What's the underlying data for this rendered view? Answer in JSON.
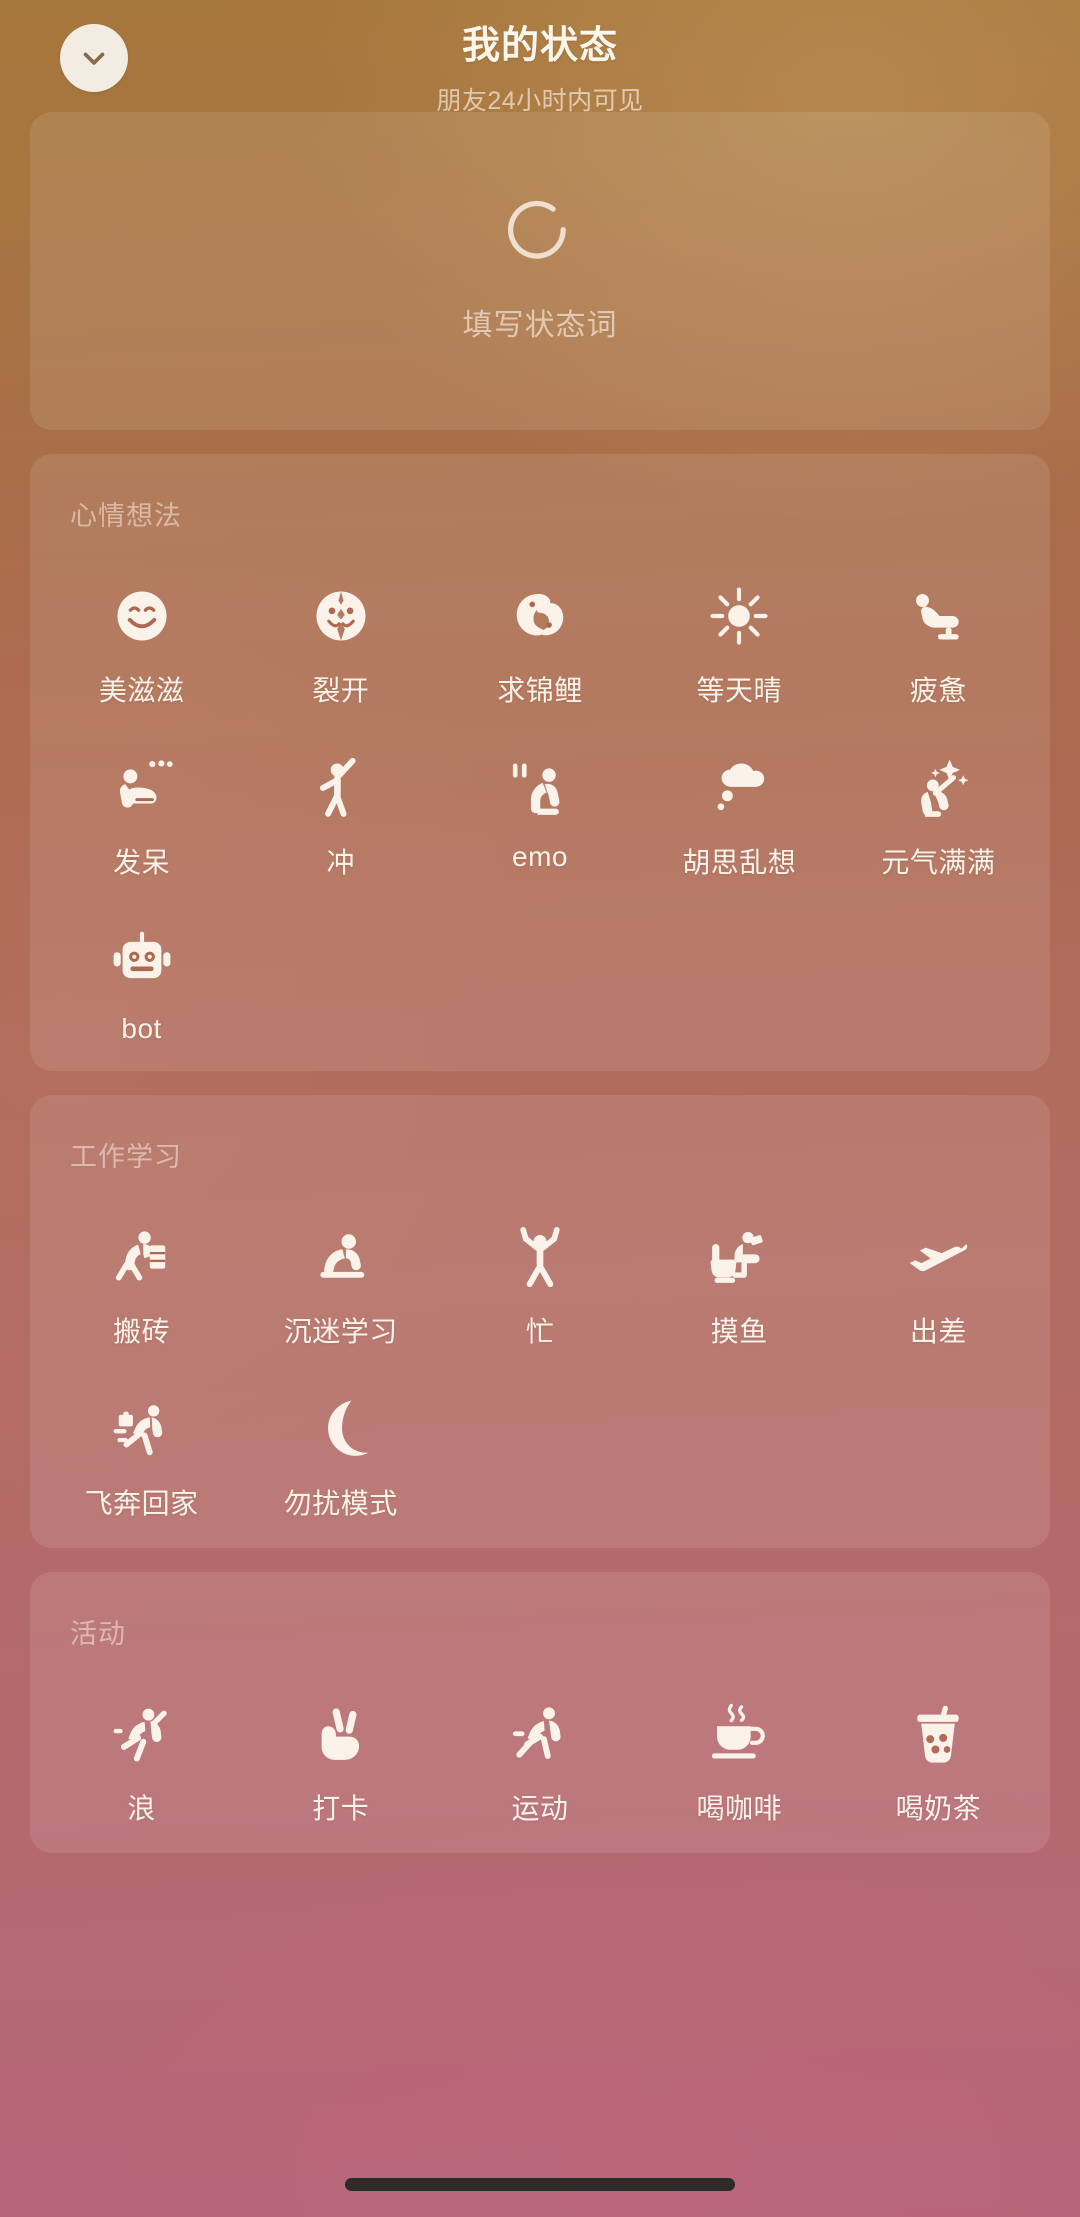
{
  "header": {
    "title": "我的状态",
    "subtitle": "朋友24小时内可见",
    "close_icon": "chevron-down-icon"
  },
  "composer": {
    "icon": "circle-ring-icon",
    "placeholder": "填写状态词"
  },
  "colors": {
    "gradient_top": "#a6773c",
    "gradient_mid": "#b06b5b",
    "gradient_bottom": "#b6657a",
    "card_fill": "rgba(255,255,255,0.10)",
    "icon_fill": "#fbf2ea",
    "label_color": "#fbf2ea",
    "section_title_color": "rgba(255,246,238,0.50)"
  },
  "sections": [
    {
      "title": "心情想法",
      "items": [
        {
          "label": "美滋滋",
          "icon": "smiling-face-icon"
        },
        {
          "label": "裂开",
          "icon": "cracked-face-icon"
        },
        {
          "label": "求锦鲤",
          "icon": "koi-fish-icon"
        },
        {
          "label": "等天晴",
          "icon": "sun-icon"
        },
        {
          "label": "疲惫",
          "icon": "exhausted-person-icon"
        },
        {
          "label": "发呆",
          "icon": "daydreaming-person-icon"
        },
        {
          "label": "冲",
          "icon": "cheering-person-icon"
        },
        {
          "label": "emo",
          "icon": "crouching-person-icon"
        },
        {
          "label": "胡思乱想",
          "icon": "thought-cloud-icon"
        },
        {
          "label": "元气满满",
          "icon": "sparkle-person-icon"
        },
        {
          "label": "bot",
          "icon": "robot-head-icon"
        }
      ]
    },
    {
      "title": "工作学习",
      "items": [
        {
          "label": "搬砖",
          "icon": "carrying-bricks-icon"
        },
        {
          "label": "沉迷学习",
          "icon": "studying-person-icon"
        },
        {
          "label": "忙",
          "icon": "busy-person-icon"
        },
        {
          "label": "摸鱼",
          "icon": "toilet-phone-icon"
        },
        {
          "label": "出差",
          "icon": "airplane-icon"
        },
        {
          "label": "飞奔回家",
          "icon": "running-home-icon"
        },
        {
          "label": "勿扰模式",
          "icon": "crescent-moon-icon"
        }
      ]
    },
    {
      "title": "活动",
      "items": [
        {
          "label": "浪",
          "icon": "jumping-person-icon"
        },
        {
          "label": "打卡",
          "icon": "peace-hand-icon"
        },
        {
          "label": "运动",
          "icon": "running-person-icon"
        },
        {
          "label": "喝咖啡",
          "icon": "coffee-cup-icon"
        },
        {
          "label": "喝奶茶",
          "icon": "bubble-tea-icon"
        }
      ]
    }
  ],
  "home_indicator": "home-indicator-bar"
}
